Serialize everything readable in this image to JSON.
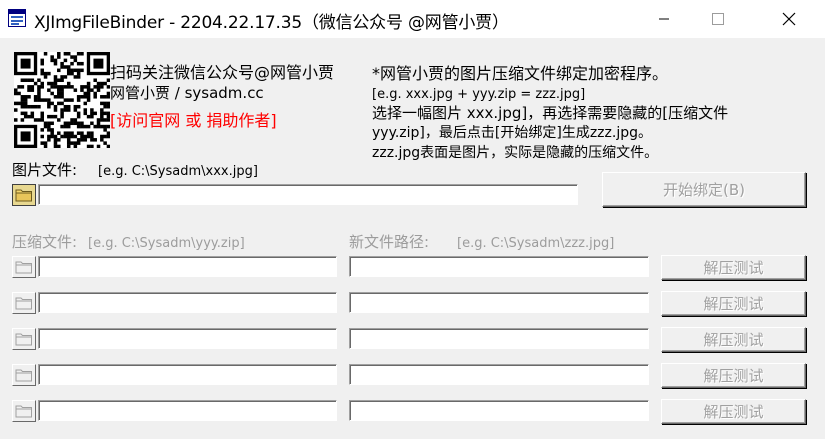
{
  "window": {
    "title": "XJImgFileBinder - 2204.22.17.35（微信公众号 @网管小贾）",
    "controls": {
      "minimize": "minimize-icon",
      "maximize": "maximize-icon",
      "close": "close-icon"
    }
  },
  "promo": {
    "line1": "扫码关注微信公众号@网管小贾",
    "line2": "网管小贾 / sysadm.cc",
    "link": "[访问官网 或 捐助作者]"
  },
  "description": {
    "line1": "*网管小贾的图片压缩文件绑定加密程序。",
    "line2": "[e.g. xxx.jpg + yyy.zip = zzz.jpg]",
    "line3": "选择一幅图片 xxx.jpg]，再选择需要隐藏的[压缩文件",
    "line4": "yyy.zip]，最后点击[开始绑定]生成zzz.jpg。",
    "line5": "zzz.jpg表面是图片，实际是隐藏的压缩文件。"
  },
  "image_file": {
    "label": "图片文件:",
    "hint": "[e.g. C:\\Sysadm\\xxx.jpg]",
    "value": "",
    "start_button": "开始绑定(B)"
  },
  "archive": {
    "label": "压缩文件:",
    "hint": "[e.g. C:\\Sysadm\\yyy.zip]"
  },
  "new_path": {
    "label": "新文件路径:",
    "hint": "[e.g. C:\\Sysadm\\zzz.jpg]"
  },
  "rows": [
    {
      "archive_value": "",
      "path_value": "",
      "test_button": "解压测试"
    },
    {
      "archive_value": "",
      "path_value": "",
      "test_button": "解压测试"
    },
    {
      "archive_value": "",
      "path_value": "",
      "test_button": "解压测试"
    },
    {
      "archive_value": "",
      "path_value": "",
      "test_button": "解压测试"
    },
    {
      "archive_value": "",
      "path_value": "",
      "test_button": "解压测试"
    }
  ],
  "colors": {
    "link": "#ff0000",
    "disabled_text": "#a0a0a0",
    "background": "#f0f0f0"
  }
}
